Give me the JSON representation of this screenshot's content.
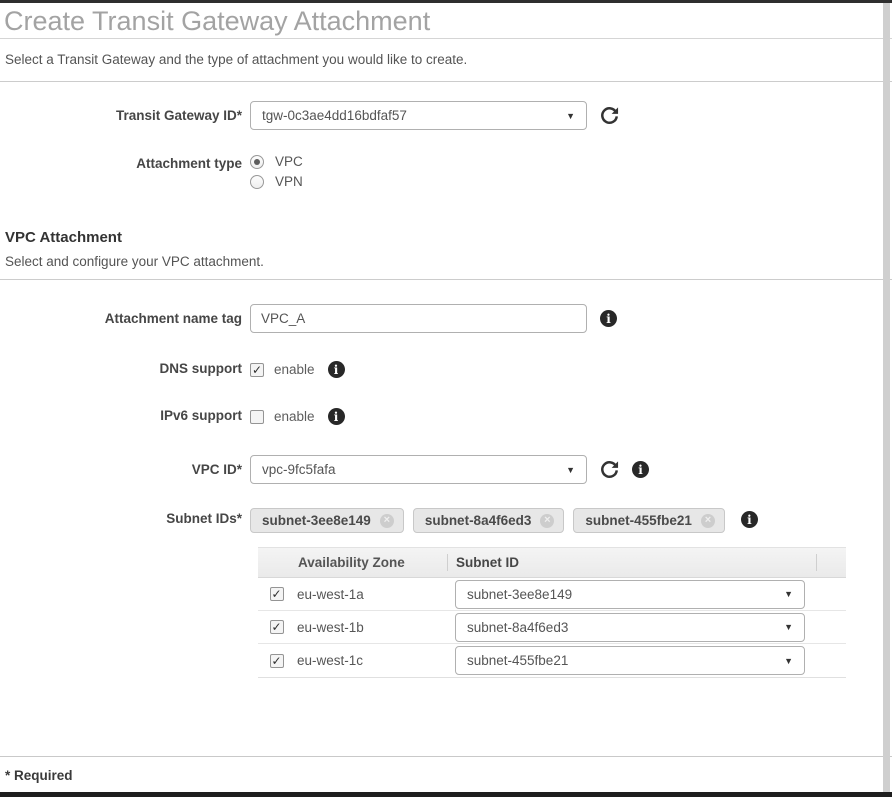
{
  "page": {
    "title": "Create Transit Gateway Attachment",
    "subtitle": "Select a Transit Gateway and the type of attachment you would like to create.",
    "required_note": "* Required"
  },
  "glyphs": {
    "caret": "▼",
    "check": "✓",
    "close": "×",
    "info": "i"
  },
  "transit_gateway": {
    "label": "Transit Gateway ID*",
    "value": "tgw-0c3ae4dd16bdfaf57"
  },
  "attachment_type": {
    "label": "Attachment type",
    "options": [
      {
        "label": "VPC",
        "selected": true
      },
      {
        "label": "VPN",
        "selected": false
      }
    ]
  },
  "vpc_attachment": {
    "heading": "VPC Attachment",
    "subtitle": "Select and configure your VPC attachment.",
    "name_tag": {
      "label": "Attachment name tag",
      "value": "VPC_A"
    },
    "dns_support": {
      "label": "DNS support",
      "checkbox_label": "enable",
      "checked": true
    },
    "ipv6_support": {
      "label": "IPv6 support",
      "checkbox_label": "enable",
      "checked": false
    },
    "vpc_id": {
      "label": "VPC ID*",
      "value": "vpc-9fc5fafa"
    },
    "subnet_ids": {
      "label": "Subnet IDs*",
      "tags": [
        "subnet-3ee8e149",
        "subnet-8a4f6ed3",
        "subnet-455fbe21"
      ]
    }
  },
  "subnet_table": {
    "columns": [
      "Availability Zone",
      "Subnet ID"
    ],
    "rows": [
      {
        "checked": true,
        "availability_zone": "eu-west-1a",
        "subnet_id": "subnet-3ee8e149"
      },
      {
        "checked": true,
        "availability_zone": "eu-west-1b",
        "subnet_id": "subnet-8a4f6ed3"
      },
      {
        "checked": true,
        "availability_zone": "eu-west-1c",
        "subnet_id": "subnet-455fbe21"
      }
    ]
  },
  "colors": {
    "title_gray": "#a3a3a3",
    "label_dark": "#464646",
    "accent_dark": "#282828",
    "tag_bg": "#e7e7e7",
    "table_header_bg": "#eeeeee",
    "bottom_bar": "#1e1e1e"
  }
}
